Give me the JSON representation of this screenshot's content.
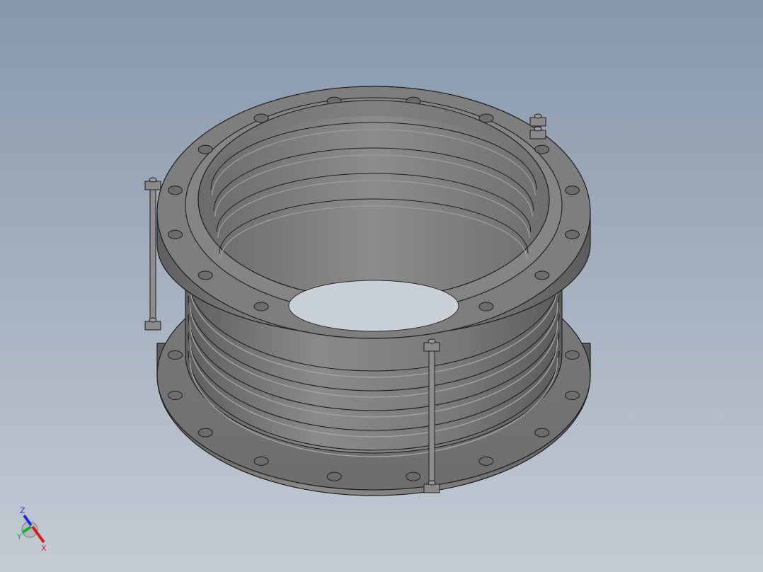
{
  "viewport": {
    "background_top": "#8797ac",
    "background_bottom": "#c4cbd4"
  },
  "model": {
    "part_color": "#7d7d7d",
    "edge_color": "#1e1e1e",
    "bolt_holes_per_flange": 16,
    "tie_rods": 3,
    "convolutions": 5
  },
  "triad": {
    "z_label": "Z",
    "y_label": "Y",
    "x_label": "X",
    "z_color": "#1c2fd6",
    "y_color": "#18b034",
    "x_color": "#d61c1c"
  }
}
